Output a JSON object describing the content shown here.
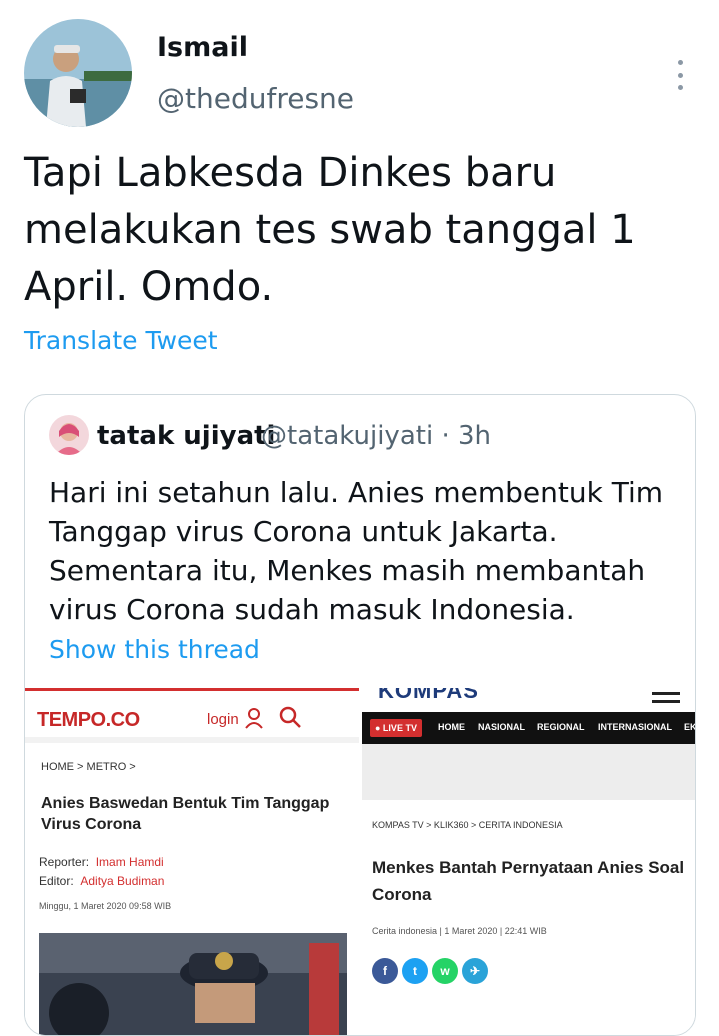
{
  "author": {
    "name": "Ismail",
    "handle": "@thedufresne"
  },
  "tweet": {
    "text": "Tapi Labkesda Dinkes baru melakukan tes swab tanggal 1 April. Omdo."
  },
  "translate_label": "Translate Tweet",
  "quoted": {
    "name": "tatak ujiyati",
    "meta": "@tatakujiyati · 3h",
    "text": "Hari ini setahun lalu. Anies membentuk Tim Tanggap virus Corona untuk Jakarta. Sementara itu, Menkes masih membantah virus Corona sudah masuk Indonesia.",
    "show_thread": "Show this thread"
  },
  "tempo": {
    "logo": "TEMPO.CO",
    "login": "login",
    "breadcrumb": "HOME  >  METRO  >",
    "title": "Anies Baswedan Bentuk Tim Tanggap Virus Corona",
    "reporter_label": "Reporter:",
    "reporter": "Imam Hamdi",
    "editor_label": "Editor:",
    "editor": "Aditya Budiman",
    "date": "Minggu, 1 Maret 2020 09:58 WIB"
  },
  "kompas": {
    "logo": "KOMPAS",
    "live": "● LIVE TV",
    "nav": [
      "HOME",
      "NASIONAL",
      "REGIONAL",
      "INTERNASIONAL",
      "EK"
    ],
    "breadcrumb": "KOMPAS TV > KLIK360 > CERITA INDONESIA",
    "title": "Menkes Bantah Pernyataan Anies Soal Corona",
    "meta": "Cerita indonesia | 1 Maret 2020 | 22:41 WIB",
    "share": [
      "f",
      "t",
      "w",
      "✈"
    ]
  },
  "colors": {
    "accent": "#1d9bf0",
    "tempo_red": "#d32f2f",
    "kompas_blue": "#1e3b7a"
  }
}
